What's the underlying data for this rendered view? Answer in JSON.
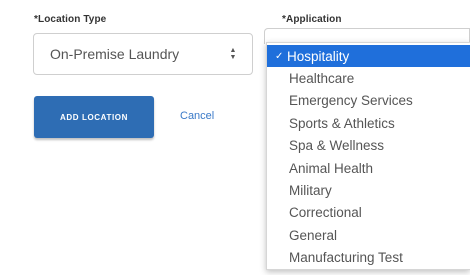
{
  "location_type": {
    "label": "*Location Type",
    "selected_value": "On-Premise Laundry",
    "arrows_icon": "up-down-arrows-icon"
  },
  "application": {
    "label": "*Application",
    "options": [
      {
        "label": "Hospitality",
        "selected": true
      },
      {
        "label": "Healthcare",
        "selected": false
      },
      {
        "label": "Emergency Services",
        "selected": false
      },
      {
        "label": "Sports & Athletics",
        "selected": false
      },
      {
        "label": "Spa & Wellness",
        "selected": false
      },
      {
        "label": "Animal Health",
        "selected": false
      },
      {
        "label": "Military",
        "selected": false
      },
      {
        "label": "Correctional",
        "selected": false
      },
      {
        "label": "General",
        "selected": false
      },
      {
        "label": "Manufacturing Test",
        "selected": false
      }
    ],
    "check_symbol": "✓"
  },
  "actions": {
    "add_label": "ADD LOCATION",
    "cancel_label": "Cancel"
  },
  "colors": {
    "primary_button": "#2e6db4",
    "link": "#3a7ac8",
    "selected_option": "#1f6fdb"
  }
}
